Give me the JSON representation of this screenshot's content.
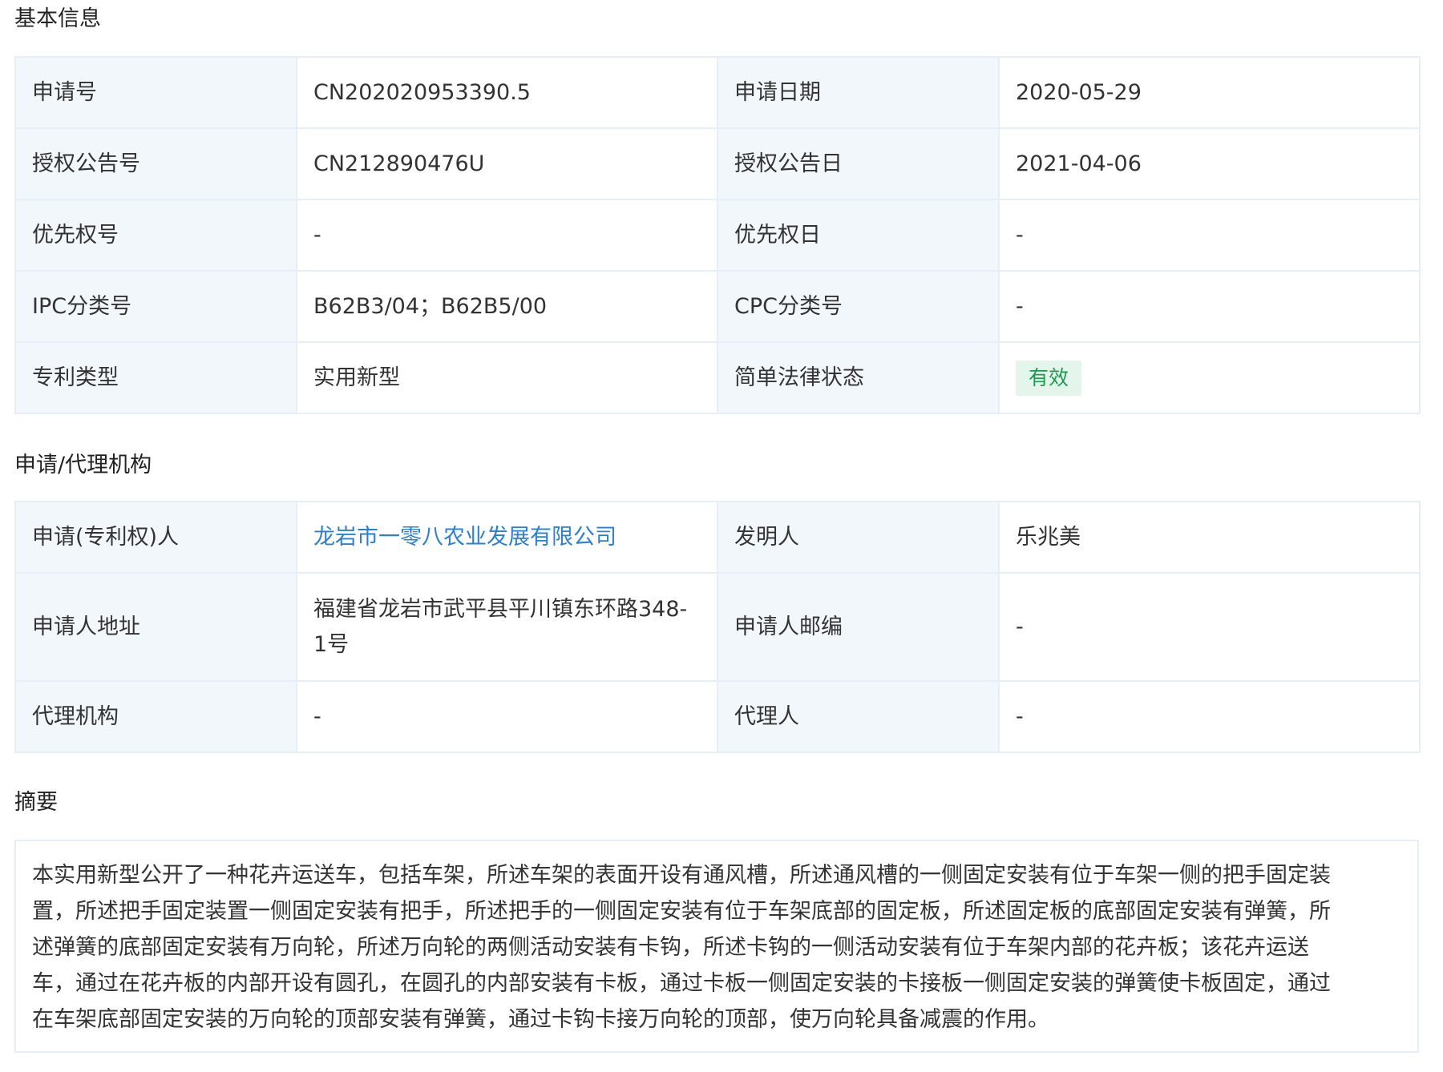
{
  "basic_info": {
    "title": "基本信息",
    "rows": [
      {
        "label1": "申请号",
        "value1": "CN202020953390.5",
        "label2": "申请日期",
        "value2": "2020-05-29"
      },
      {
        "label1": "授权公告号",
        "value1": "CN212890476U",
        "label2": "授权公告日",
        "value2": "2021-04-06"
      },
      {
        "label1": "优先权号",
        "value1": "-",
        "label2": "优先权日",
        "value2": "-"
      },
      {
        "label1": "IPC分类号",
        "value1": "B62B3/04；B62B5/00",
        "label2": "CPC分类号",
        "value2": "-"
      },
      {
        "label1": "专利类型",
        "value1": "实用新型",
        "label2": "简单法律状态",
        "value2": "有效"
      }
    ],
    "status_color": "#1e9a4f",
    "status_bg": "#e4f6ec"
  },
  "agency": {
    "title": "申请/代理机构",
    "rows": [
      {
        "label1": "申请(专利权)人",
        "value1": "龙岩市一零八农业发展有限公司",
        "label2": "发明人",
        "value2": "乐兆美"
      },
      {
        "label1": "申请人地址",
        "value1_line1": "福建省龙岩市武平县平川镇东环路348-",
        "value1_line2": "1号",
        "label2": "申请人邮编",
        "value2": "-"
      },
      {
        "label1": "代理机构",
        "value1": "-",
        "label2": "代理人",
        "value2": "-"
      }
    ],
    "link_color": "#2a80d8"
  },
  "abstract": {
    "title": "摘要",
    "lines": [
      "本实用新型公开了一种花卉运送车，包括车架，所述车架的表面开设有通风槽，所述通风槽的一侧固定安装有位于车架一侧的把手固定装",
      "置，所述把手固定装置一侧固定安装有把手，所述把手的一侧固定安装有位于车架底部的固定板，所述固定板的底部固定安装有弹簧，所",
      "述弹簧的底部固定安装有万向轮，所述万向轮的两侧活动安装有卡钩，所述卡钩的一侧活动安装有位于车架内部的花卉板；该花卉运送",
      "车，通过在花卉板的内部开设有圆孔，在圆孔的内部安装有卡板，通过卡板一侧固定安装的卡接板一侧固定安装的弹簧使卡板固定，通过",
      "在车架底部固定安装的万向轮的顶部安装有弹簧，通过卡钩卡接万向轮的顶部，使万向轮具备减震的作用。"
    ]
  }
}
